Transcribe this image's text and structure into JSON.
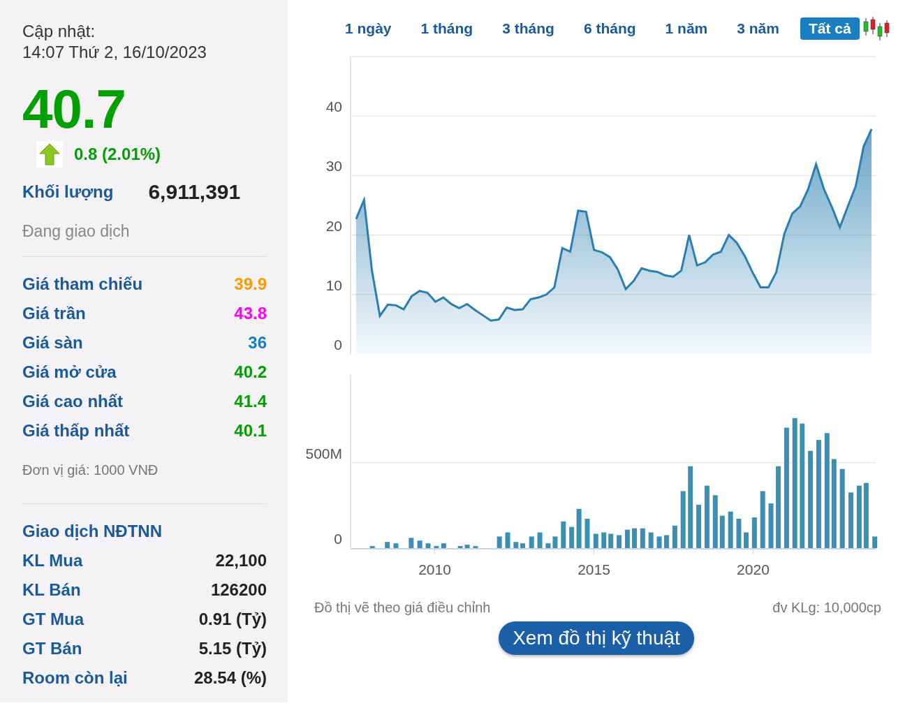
{
  "summary": {
    "update_label": "Cập nhật:",
    "update_time": "14:07 Thứ 2, 16/10/2023",
    "price": "40.7",
    "change": "0.8 (2.01%)",
    "volume_label": "Khối lượng",
    "volume": "6,911,391",
    "status": "Đang giao dịch"
  },
  "prices": [
    {
      "label": "Giá tham chiếu",
      "value": "39.9",
      "color": "#ff9900"
    },
    {
      "label": "Giá trần",
      "value": "43.8",
      "color": "#ff00ff"
    },
    {
      "label": "Giá sàn",
      "value": "36",
      "color": "#1a7fc0"
    },
    {
      "label": "Giá mở cửa",
      "value": "40.2",
      "color": "#00a000"
    },
    {
      "label": "Giá cao nhất",
      "value": "41.4",
      "color": "#00a000"
    },
    {
      "label": "Giá thấp nhất",
      "value": "40.1",
      "color": "#00a000"
    }
  ],
  "unit_note": "Đơn vị giá: 1000 VNĐ",
  "foreign": {
    "title": "Giao dịch NĐTNN",
    "rows": [
      {
        "label": "KL Mua",
        "value": "22,100"
      },
      {
        "label": "KL Bán",
        "value": "126200"
      },
      {
        "label": "GT Mua",
        "value": "0.91 (Tỷ)"
      },
      {
        "label": "GT Bán",
        "value": "5.15 (Tỷ)"
      },
      {
        "label": "Room còn lại",
        "value": "28.54 (%)"
      }
    ]
  },
  "tabs": [
    {
      "label": "1 ngày",
      "selected": false
    },
    {
      "label": "1 tháng",
      "selected": false
    },
    {
      "label": "3 tháng",
      "selected": false
    },
    {
      "label": "6 tháng",
      "selected": false
    },
    {
      "label": "1 năm",
      "selected": false
    },
    {
      "label": "3 năm",
      "selected": false
    },
    {
      "label": "Tất cả",
      "selected": true
    }
  ],
  "price_chart": {
    "chart_data": {
      "type": "area",
      "grid": true,
      "ylim": [
        0,
        50
      ],
      "yticks": [
        0,
        10,
        20,
        30,
        40
      ],
      "series": [
        {
          "color": "#2a7fb0",
          "values": [
            22.7,
            25.9,
            14,
            6.4,
            8.3,
            8.2,
            7.5,
            9.7,
            10.6,
            10.3,
            8.8,
            9.5,
            8.4,
            7.7,
            8.4,
            7.4,
            6.5,
            5.6,
            5.8,
            7.8,
            7.4,
            7.5,
            9.2,
            9.5,
            10,
            11.2,
            17.8,
            17.2,
            24.1,
            23.9,
            17.5,
            17.1,
            16.3,
            14.2,
            10.9,
            12.3,
            14.4,
            14,
            13.8,
            13.2,
            13,
            14,
            20,
            14.9,
            15.4,
            16.7,
            17.2,
            20,
            18.7,
            16.5,
            13.7,
            11.2,
            11.2,
            13.8,
            20.2,
            23.6,
            24.8,
            27.7,
            31.9,
            27.7,
            24.7,
            21.3,
            24.8,
            28.2,
            34.9,
            37.8
          ]
        }
      ]
    }
  },
  "volume_chart": {
    "chart_data": {
      "type": "bar",
      "grid": true,
      "xlim": [
        2007.4,
        2023.85
      ],
      "ylim": [
        0,
        1015
      ],
      "xticks": [
        2010,
        2015,
        2020
      ],
      "yticks": [
        0,
        {
          "value": 500,
          "label": "500M"
        }
      ],
      "x": [
        2008.03,
        2008.5,
        2008.77,
        2009.25,
        2009.52,
        2009.78,
        2010.04,
        2010.27,
        2010.79,
        2011.01,
        2011.27,
        2012.02,
        2012.28,
        2012.54,
        2012.75,
        2013.03,
        2013.29,
        2013.55,
        2013.77,
        2014.03,
        2014.29,
        2014.52,
        2014.78,
        2015.05,
        2015.3,
        2015.52,
        2015.78,
        2016.04,
        2016.26,
        2016.52,
        2016.78,
        2017.04,
        2017.27,
        2017.53,
        2017.79,
        2018.02,
        2018.28,
        2018.54,
        2018.8,
        2019.02,
        2019.28,
        2019.54,
        2019.77,
        2020.03,
        2020.29,
        2020.55,
        2020.78,
        2021.04,
        2021.3,
        2021.53,
        2021.79,
        2022.05,
        2022.31,
        2022.53,
        2022.79,
        2023.06,
        2023.32,
        2023.54,
        2023.81
      ],
      "series": [
        {
          "color": "#3a8fb5",
          "values": [
            12,
            36,
            28,
            60,
            44,
            28,
            12,
            28,
            12,
            20,
            12,
            68,
            92,
            36,
            28,
            68,
            92,
            28,
            68,
            156,
            124,
            230,
            172,
            84,
            92,
            84,
            76,
            108,
            116,
            116,
            92,
            68,
            76,
            132,
            334,
            480,
            254,
            366,
            310,
            190,
            214,
            172,
            92,
            180,
            334,
            262,
            480,
            706,
            762,
            730,
            570,
            634,
            674,
            522,
            464,
            326,
            366,
            382,
            68
          ]
        }
      ]
    }
  },
  "chart_note": "Đồ thị vẽ theo giá điều chỉnh",
  "volume_unit": "đv KLg: 10,000cp",
  "technical_button": "Xem đồ thị kỹ thuật"
}
